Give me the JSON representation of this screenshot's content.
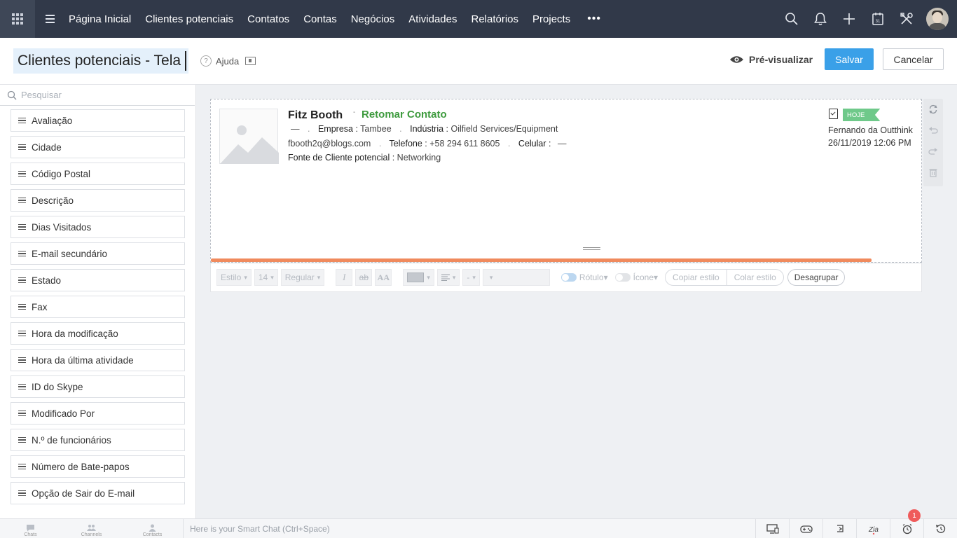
{
  "nav": {
    "items": [
      "Página Inicial",
      "Clientes potenciais",
      "Contatos",
      "Contas",
      "Negócios",
      "Atividades",
      "Relatórios",
      "Projects"
    ],
    "more": "•••"
  },
  "header": {
    "title_value": "Clientes potenciais - Tela",
    "help_label": "Ajuda",
    "preview_label": "Pré-visualizar",
    "save_label": "Salvar",
    "cancel_label": "Cancelar"
  },
  "sidebar": {
    "search_placeholder": "Pesquisar",
    "fields": [
      "Avaliação",
      "Cidade",
      "Código Postal",
      "Descrição",
      "Dias Visitados",
      "E-mail secundário",
      "Estado",
      "Fax",
      "Hora da modificação",
      "Hora da última atividade",
      "ID do Skype",
      "Modificado Por",
      "N.º de funcionários",
      "Número de Bate-papos",
      "Opção de Sair do E-mail"
    ]
  },
  "record": {
    "name": "Fitz Booth",
    "status": "Retomar Contato",
    "dash": "—",
    "company_label": "Empresa :",
    "company_value": "Tambee",
    "industry_label": "Indústria :",
    "industry_value": "Oilfield Services/Equipment",
    "email": "fbooth2q@blogs.com",
    "phone_label": "Telefone :",
    "phone_value": "+58 294 611 8605",
    "mobile_label": "Celular :",
    "mobile_value": "—",
    "source_label": "Fonte de Cliente potencial :",
    "source_value": "Networking",
    "badge": "HOJE",
    "owner": "Fernando da Outthink",
    "datetime": "26/11/2019 12:06 PM"
  },
  "toolbar": {
    "style": "Estilo",
    "size": "14",
    "weight": "Regular",
    "italic": "I",
    "strike": "ab",
    "caps": "AA",
    "dash_dd": "-",
    "label_toggle": "Rótulo",
    "icon_toggle": "Ícone",
    "copy_style": "Copiar estilo",
    "paste_style": "Colar estilo",
    "ungroup": "Desagrupar"
  },
  "bottombar": {
    "tabs": [
      "Chats",
      "Channels",
      "Contacts"
    ],
    "smart_chat_placeholder": "Here is your Smart Chat (Ctrl+Space)",
    "notification_count": "1"
  },
  "colors": {
    "topbar": "#313949",
    "primary": "#3aa0e8",
    "status_green": "#3d9a3d",
    "accent_orange": "#f08a5d",
    "badge_green": "#6fc98a"
  }
}
